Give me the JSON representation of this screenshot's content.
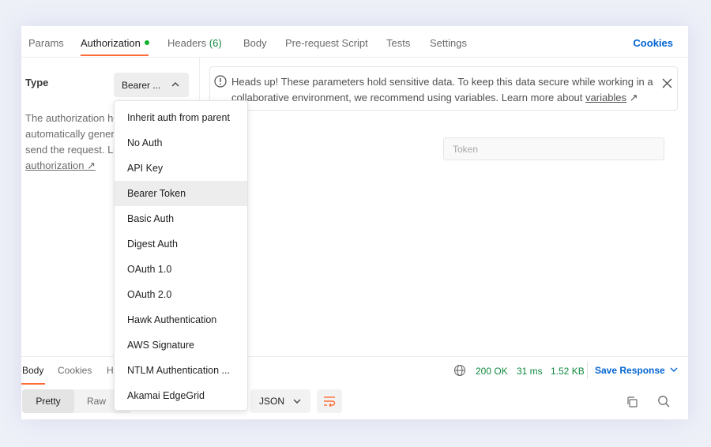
{
  "request_tabs": [
    {
      "label": "Params"
    },
    {
      "label": "Authorization"
    },
    {
      "label": "Headers",
      "count": "(6)"
    },
    {
      "label": "Body"
    },
    {
      "label": "Pre-request Script"
    },
    {
      "label": "Tests"
    },
    {
      "label": "Settings"
    }
  ],
  "cookies_link": "Cookies",
  "auth": {
    "type_label": "Type",
    "selected_type": "Bearer ...",
    "description_lines": [
      "The authorization he",
      "automatically gener",
      "send the request. Le"
    ],
    "description_link": "authorization ↗"
  },
  "banner": {
    "text": "Heads up! These parameters hold sensitive data. To keep this data secure while working in a collaborative environment, we recommend using variables. Learn more about ",
    "link": "variables",
    "link_suffix": " ↗"
  },
  "token_placeholder": "Token",
  "dropdown_items": [
    "Inherit auth from parent",
    "No Auth",
    "API Key",
    "Bearer Token",
    "Basic Auth",
    "Digest Auth",
    "OAuth 1.0",
    "OAuth 2.0",
    "Hawk Authentication",
    "AWS Signature",
    "NTLM Authentication ...",
    "Akamai EdgeGrid"
  ],
  "dropdown_hovered": "Bearer Token",
  "response": {
    "tabs": [
      "Body",
      "Cookies",
      "H"
    ],
    "status": "200 OK",
    "time": "31 ms",
    "size": "1.52 KB",
    "save_label": "Save Response",
    "view_modes": [
      "Pretty",
      "Raw"
    ],
    "format": "JSON"
  },
  "colors": {
    "accent": "#ff6c37",
    "link": "#0265d2",
    "success": "#0f8a3e"
  }
}
